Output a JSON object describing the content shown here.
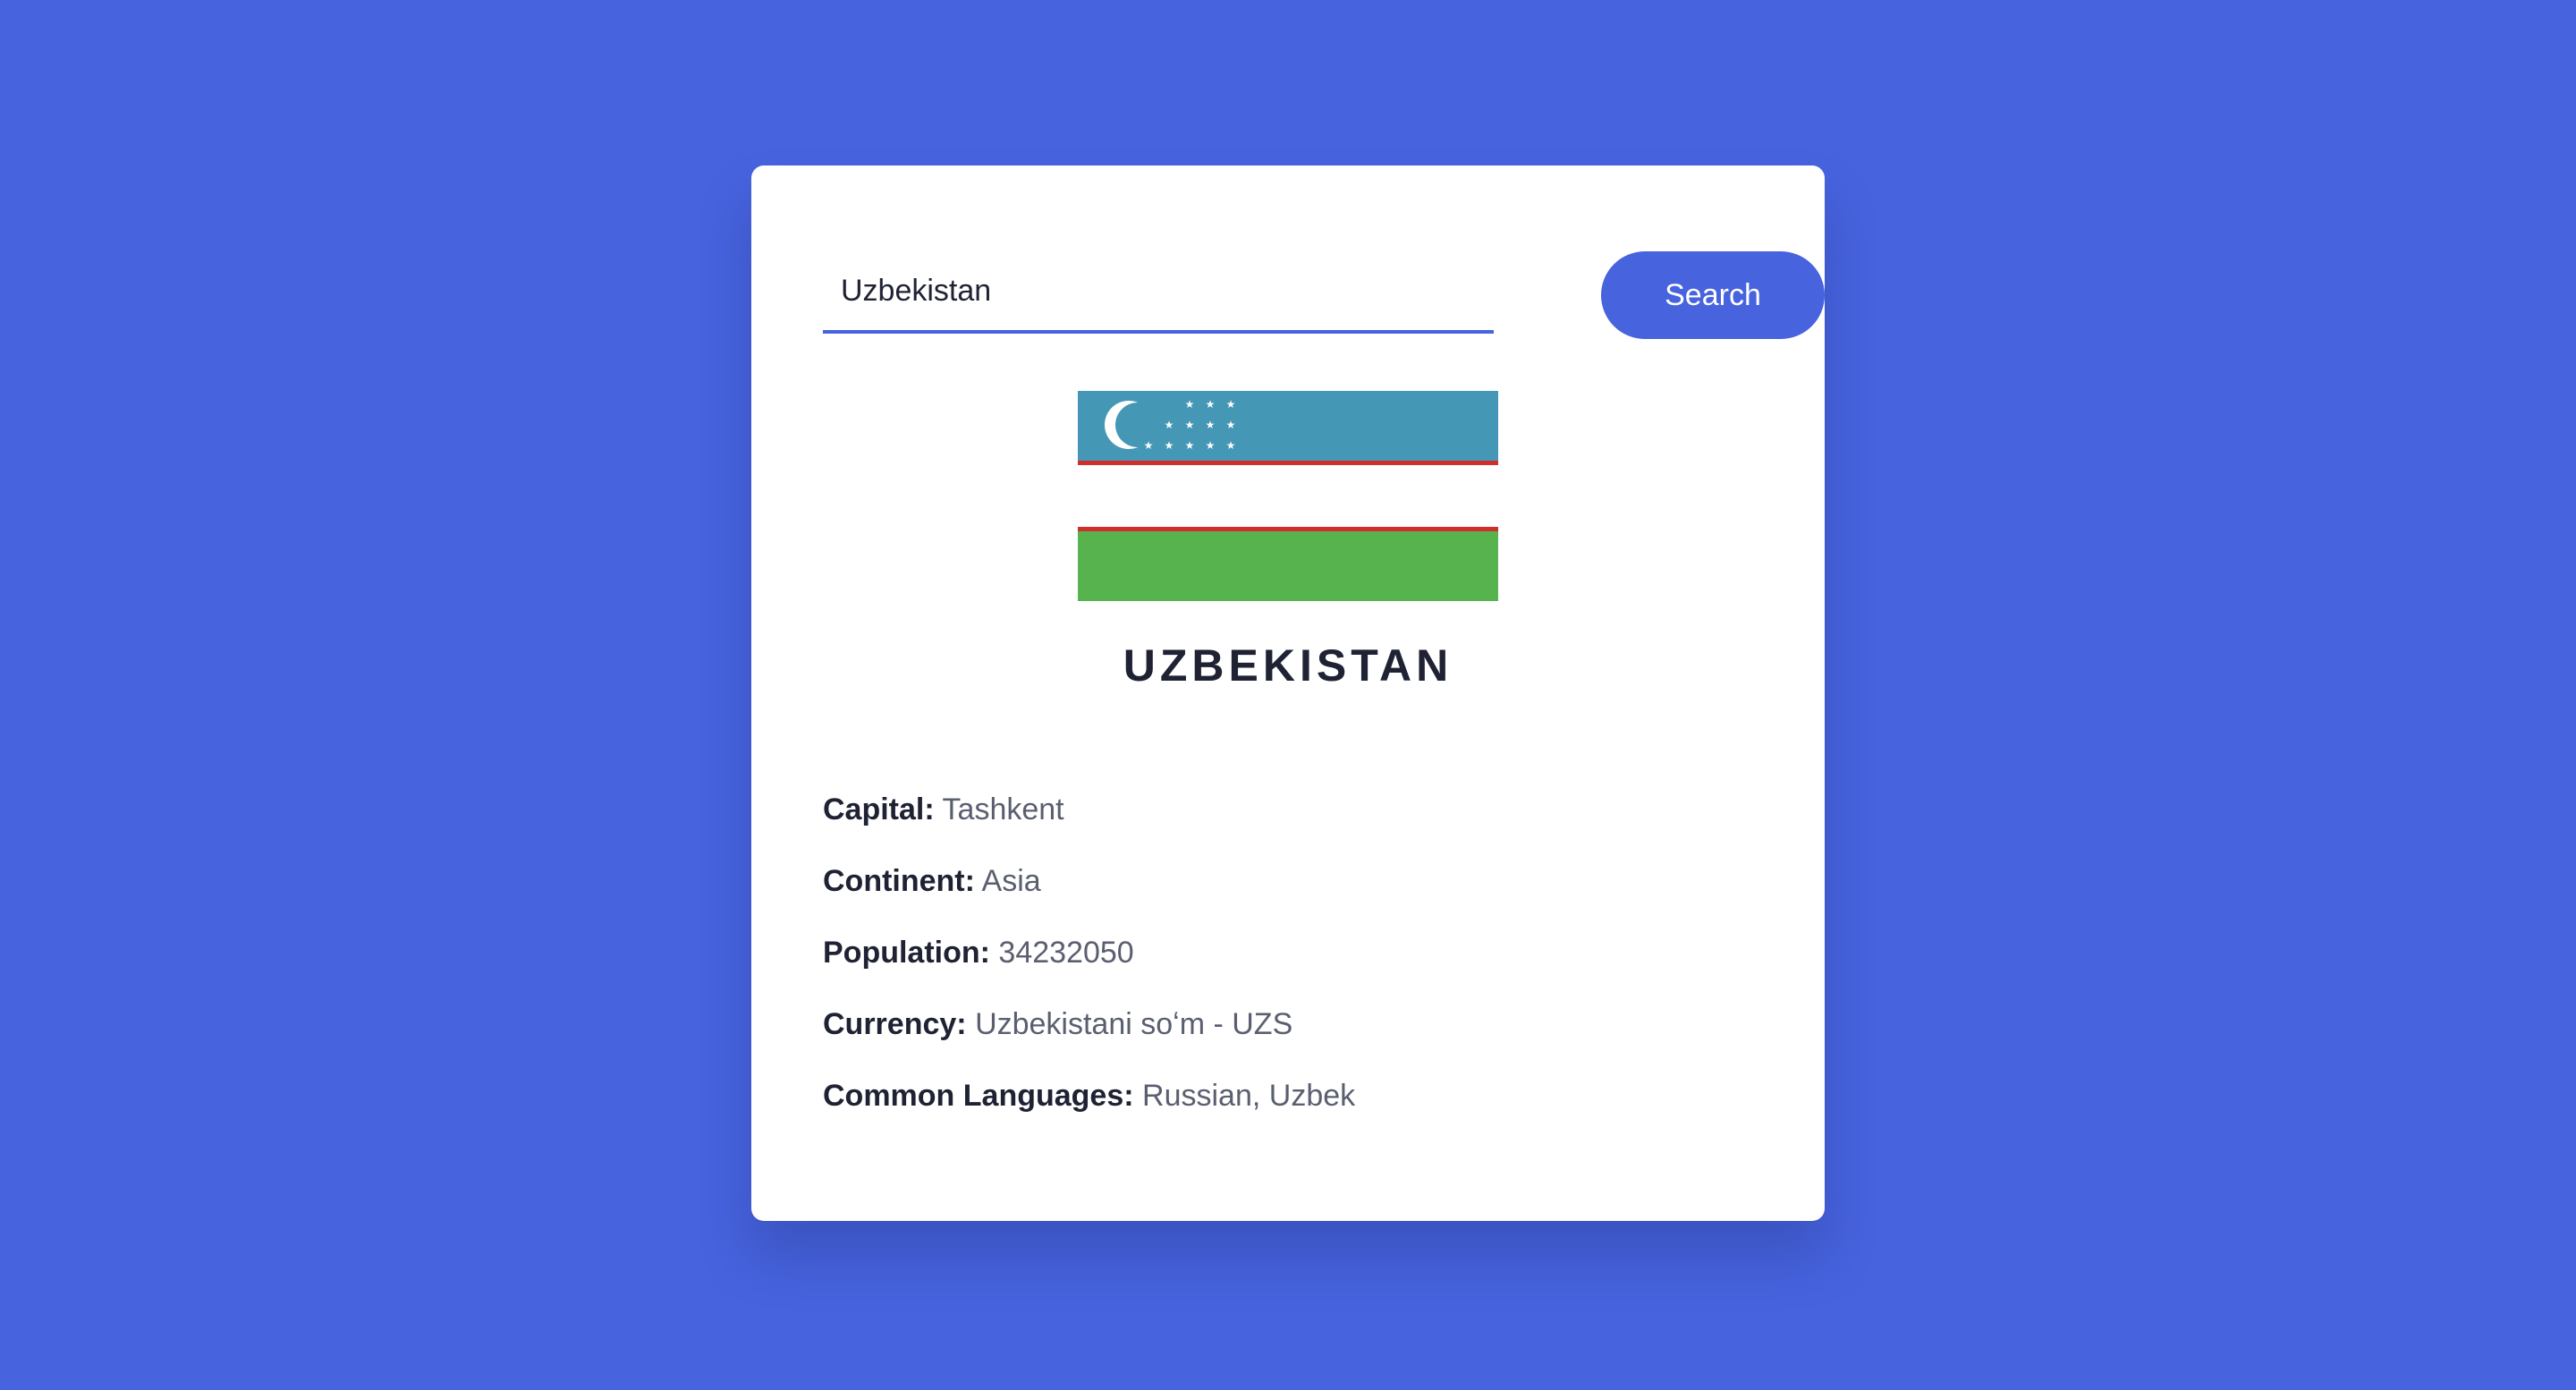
{
  "search": {
    "value": "Uzbekistan",
    "button_label": "Search"
  },
  "flag": {
    "name": "uzbekistan-flag",
    "colors": {
      "blue": "#4597b6",
      "red": "#ce2f2b",
      "white": "#ffffff",
      "green": "#56b34d"
    }
  },
  "country": {
    "name": "UZBEKISTAN"
  },
  "details": [
    {
      "label": "Capital:",
      "value": "Tashkent"
    },
    {
      "label": "Continent:",
      "value": "Asia"
    },
    {
      "label": "Population:",
      "value": "34232050"
    },
    {
      "label": "Currency:",
      "value": "Uzbekistani soʻm - UZS"
    },
    {
      "label": "Common Languages:",
      "value": "Russian, Uzbek"
    }
  ],
  "colors": {
    "background": "#4763de",
    "accent": "#4763de",
    "card": "#ffffff",
    "text_dark": "#1e2233",
    "text_muted": "#5a5f70"
  }
}
